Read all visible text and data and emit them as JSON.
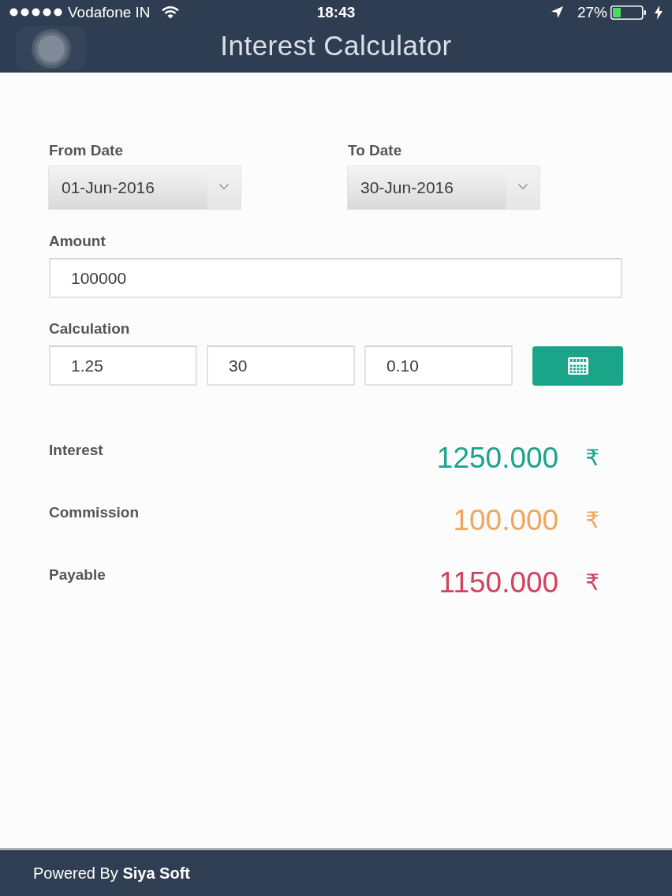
{
  "status_bar": {
    "carrier": "Vodafone IN",
    "time": "18:43",
    "battery": "27%"
  },
  "header": {
    "title": "Interest Calculator"
  },
  "dates": [
    {
      "label": "From Date",
      "value": "01-Jun-2016"
    },
    {
      "label": "To Date",
      "value": "30-Jun-2016"
    }
  ],
  "amount": {
    "label": "Amount",
    "value": "100000"
  },
  "calculation": {
    "label": "Calculation",
    "fields": [
      "1.25",
      "30",
      "0.10"
    ]
  },
  "results": [
    {
      "label": "Interest",
      "value": "1250.000",
      "currency": "₹",
      "color": "#1ba38b"
    },
    {
      "label": "Commission",
      "value": "100.000",
      "currency": "₹",
      "color": "#f0a75c"
    },
    {
      "label": "Payable",
      "value": "1150.000",
      "currency": "₹",
      "color": "#d6415e"
    }
  ],
  "footer": {
    "text": "Powered By **Siya Soft**"
  }
}
